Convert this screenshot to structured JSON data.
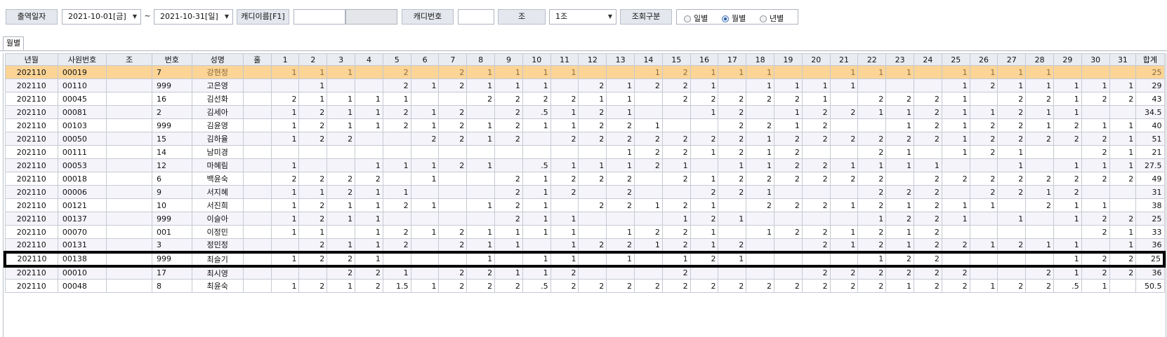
{
  "toolbar": {
    "date_label": "출역일자",
    "date_from": "2021-10-01[금]",
    "tilde": "~",
    "date_to": "2021-10-31[일]",
    "caddie_name_label": "캐디이름[F1]",
    "caddie_name_value": "",
    "caddie_no_label": "캐디번호",
    "caddie_no_value": "",
    "group_label": "조",
    "group_value": "1조",
    "query_label": "조회구분",
    "radio_options": [
      "일별",
      "월별",
      "년별"
    ],
    "radio_selected": "월별"
  },
  "tabs": [
    "월별"
  ],
  "grid": {
    "columns": [
      "년월",
      "사원번호",
      "조",
      "번호",
      "성명",
      "홀",
      "1",
      "2",
      "3",
      "4",
      "5",
      "6",
      "7",
      "8",
      "9",
      "10",
      "11",
      "12",
      "13",
      "14",
      "15",
      "16",
      "17",
      "18",
      "19",
      "20",
      "21",
      "22",
      "23",
      "24",
      "25",
      "26",
      "27",
      "28",
      "29",
      "30",
      "31",
      "합계"
    ],
    "rows": [
      [
        "202110",
        "00019",
        "",
        "7",
        "강현정",
        "",
        "1",
        "1",
        "1",
        "",
        "2",
        "",
        "2",
        "1",
        "1",
        "1",
        "1",
        "",
        "",
        "1",
        "2",
        "1",
        "1",
        "1",
        "",
        "",
        "1",
        "1",
        "1",
        "",
        "1",
        "1",
        "1",
        "1",
        "",
        "",
        "",
        "25"
      ],
      [
        "202110",
        "00110",
        "",
        "999",
        "고은영",
        "",
        "",
        "1",
        "",
        "",
        "2",
        "1",
        "2",
        "1",
        "1",
        "1",
        "",
        "2",
        "1",
        "2",
        "2",
        "1",
        "",
        "1",
        "1",
        "1",
        "1",
        "",
        "",
        "",
        "1",
        "2",
        "1",
        "1",
        "1",
        "1",
        "1",
        "29"
      ],
      [
        "202110",
        "00045",
        "",
        "16",
        "김선화",
        "",
        "2",
        "1",
        "1",
        "1",
        "1",
        "",
        "",
        "2",
        "2",
        "2",
        "2",
        "1",
        "1",
        "",
        "2",
        "2",
        "2",
        "2",
        "2",
        "1",
        "",
        "2",
        "2",
        "2",
        "1",
        "",
        "2",
        "2",
        "1",
        "2",
        "2",
        "43"
      ],
      [
        "202110",
        "00081",
        "",
        "2",
        "김세아",
        "",
        "1",
        "2",
        "1",
        "1",
        "2",
        "1",
        "2",
        "",
        "2",
        ".5",
        "1",
        "2",
        "1",
        "",
        "",
        "1",
        "2",
        "",
        "1",
        "2",
        "2",
        "1",
        "1",
        "2",
        "1",
        "1",
        "2",
        "1",
        "1",
        "",
        "",
        "34.5"
      ],
      [
        "202110",
        "00103",
        "",
        "999",
        "김윤영",
        "",
        "1",
        "2",
        "1",
        "1",
        "2",
        "1",
        "2",
        "1",
        "2",
        "1",
        "1",
        "2",
        "2",
        "1",
        "",
        "",
        "2",
        "2",
        "1",
        "2",
        "",
        "",
        "1",
        "2",
        "1",
        "2",
        "2",
        "1",
        "2",
        "1",
        "1",
        "40"
      ],
      [
        "202110",
        "00050",
        "",
        "15",
        "김하율",
        "",
        "1",
        "2",
        "2",
        "",
        "",
        "2",
        "2",
        "1",
        "2",
        "",
        "2",
        "2",
        "2",
        "2",
        "2",
        "2",
        "2",
        "1",
        "2",
        "2",
        "2",
        "2",
        "2",
        "2",
        "1",
        "2",
        "2",
        "2",
        "2",
        "2",
        "1",
        "51"
      ],
      [
        "202110",
        "00111",
        "",
        "14",
        "남미경",
        "",
        "",
        "",
        "",
        "",
        "",
        "",
        "",
        "",
        "",
        "",
        "",
        "",
        "1",
        "2",
        "2",
        "1",
        "2",
        "1",
        "2",
        "",
        "",
        "2",
        "1",
        "",
        "1",
        "2",
        "1",
        "",
        "",
        "2",
        "1",
        "21"
      ],
      [
        "202110",
        "00053",
        "",
        "12",
        "마혜림",
        "",
        "1",
        "",
        "",
        "1",
        "1",
        "1",
        "2",
        "1",
        "",
        ".5",
        "1",
        "1",
        "1",
        "2",
        "1",
        "",
        "1",
        "1",
        "2",
        "2",
        "1",
        "1",
        "1",
        "1",
        "",
        "",
        "1",
        "",
        "1",
        "1",
        "1",
        "27.5"
      ],
      [
        "202110",
        "00018",
        "",
        "6",
        "백윤숙",
        "",
        "2",
        "2",
        "2",
        "2",
        "",
        "1",
        "",
        "",
        "2",
        "1",
        "2",
        "2",
        "2",
        "",
        "2",
        "1",
        "2",
        "2",
        "2",
        "2",
        "2",
        "2",
        "",
        "2",
        "2",
        "2",
        "2",
        "2",
        "2",
        "2",
        "2",
        "49"
      ],
      [
        "202110",
        "00006",
        "",
        "9",
        "서지혜",
        "",
        "1",
        "1",
        "2",
        "1",
        "1",
        "",
        "",
        "",
        "2",
        "1",
        "2",
        "",
        "2",
        "",
        "",
        "2",
        "2",
        "1",
        "",
        "",
        "",
        "2",
        "2",
        "2",
        "",
        "2",
        "2",
        "1",
        "2",
        "",
        "",
        "31"
      ],
      [
        "202110",
        "00121",
        "",
        "10",
        "서진희",
        "",
        "1",
        "2",
        "1",
        "1",
        "2",
        "1",
        "",
        "1",
        "2",
        "1",
        "",
        "2",
        "2",
        "1",
        "2",
        "1",
        "",
        "2",
        "2",
        "2",
        "1",
        "2",
        "1",
        "2",
        "1",
        "1",
        "",
        "2",
        "1",
        "1",
        "",
        "38"
      ],
      [
        "202110",
        "00137",
        "",
        "999",
        "이슬아",
        "",
        "1",
        "2",
        "1",
        "1",
        "",
        "",
        "",
        "",
        "2",
        "1",
        "1",
        "",
        "",
        "",
        "1",
        "2",
        "1",
        "",
        "",
        "",
        "",
        "1",
        "2",
        "2",
        "1",
        "",
        "1",
        "",
        "1",
        "2",
        "2",
        "25"
      ],
      [
        "202110",
        "00070",
        "",
        "001",
        "이정민",
        "",
        "1",
        "1",
        "",
        "1",
        "2",
        "1",
        "2",
        "1",
        "1",
        "1",
        "1",
        "",
        "1",
        "2",
        "2",
        "1",
        "",
        "1",
        "2",
        "2",
        "1",
        "2",
        "1",
        "2",
        "",
        "",
        "",
        "",
        "",
        "2",
        "1",
        "33"
      ],
      [
        "202110",
        "00131",
        "",
        "3",
        "정민정",
        "",
        "",
        "2",
        "1",
        "1",
        "2",
        "",
        "2",
        "1",
        "1",
        "",
        "1",
        "2",
        "2",
        "1",
        "2",
        "1",
        "2",
        "",
        "",
        "2",
        "1",
        "2",
        "1",
        "2",
        "2",
        "1",
        "2",
        "1",
        "1",
        "",
        "1",
        "36"
      ],
      [
        "202110",
        "00138",
        "",
        "999",
        "최슬기",
        "",
        "1",
        "2",
        "2",
        "1",
        "",
        "",
        "",
        "1",
        "",
        "1",
        "1",
        "",
        "1",
        "",
        "1",
        "2",
        "1",
        "",
        "",
        "",
        "",
        "1",
        "2",
        "2",
        "",
        "",
        "",
        "",
        "1",
        "2",
        "2",
        "25"
      ],
      [
        "202110",
        "00010",
        "",
        "17",
        "최시영",
        "",
        "",
        "",
        "2",
        "2",
        "1",
        "",
        "2",
        "2",
        "1",
        "1",
        "2",
        "",
        "",
        "",
        "2",
        "",
        "",
        "",
        "",
        "2",
        "2",
        "2",
        "2",
        "2",
        "2",
        "",
        "",
        "2",
        "1",
        "2",
        "2",
        "36"
      ],
      [
        "202110",
        "00048",
        "",
        "8",
        "최윤숙",
        "",
        "1",
        "2",
        "1",
        "2",
        "1.5",
        "1",
        "2",
        "2",
        "2",
        ".5",
        "2",
        "2",
        "2",
        "2",
        "2",
        "2",
        "2",
        "2",
        "2",
        "2",
        "2",
        "2",
        "1",
        "2",
        "2",
        "1",
        "2",
        "2",
        ".5",
        "1",
        "",
        "50.5"
      ]
    ]
  }
}
